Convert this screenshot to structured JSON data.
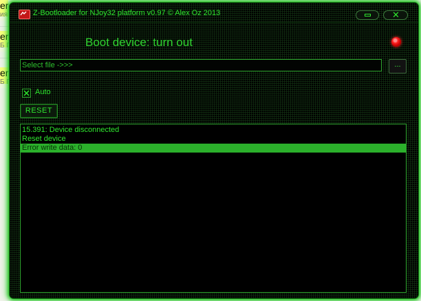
{
  "background": {
    "snippets": [
      {
        "line1": "er-",
        "line2": "ия"
      },
      {
        "line1": "er-",
        "line2": "Б П"
      },
      {
        "line1": "er-",
        "line2": "Б П"
      }
    ]
  },
  "window": {
    "title": "Z-Bootloader for NJoy32 platform v0.97 © Alex Oz 2013",
    "icon": "app-icon"
  },
  "status": {
    "title": "Boot device: turn out",
    "led_color": "#ff2020"
  },
  "file": {
    "placeholder": "Select file ->>>",
    "browse_label": "..."
  },
  "options": {
    "auto_label": "Auto",
    "auto_checked": true
  },
  "actions": {
    "reset_label": "RESET"
  },
  "log": {
    "lines": [
      "15.391: Device disconnected",
      "Reset device",
      "Error write data: 0"
    ],
    "selected_index": 2
  },
  "colors": {
    "accent": "#2ee62e",
    "selection": "#2bb02b",
    "background": "#000000",
    "glow": "#1fbf1f"
  }
}
